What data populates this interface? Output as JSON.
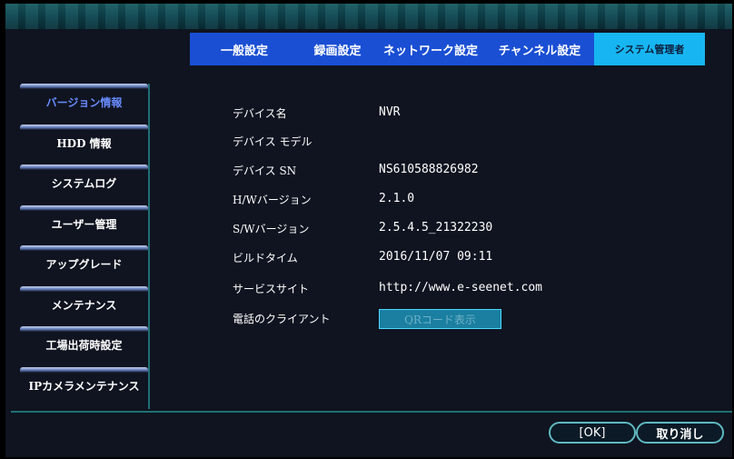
{
  "tabs": [
    {
      "label": "一般設定"
    },
    {
      "label": "録画設定"
    },
    {
      "label": "ネットワーク設定"
    },
    {
      "label": "チャンネル設定"
    },
    {
      "label": "システム管理者"
    }
  ],
  "sidebar": {
    "items": [
      {
        "label": "バージョン情報"
      },
      {
        "label": "HDD 情報"
      },
      {
        "label": "システムログ"
      },
      {
        "label": "ユーザー管理"
      },
      {
        "label": "アップグレード"
      },
      {
        "label": "メンテナンス"
      },
      {
        "label": "工場出荷時設定"
      },
      {
        "label": "IPカメラメンテナンス"
      }
    ]
  },
  "info": {
    "device_name_label": "デバイス名",
    "device_name_value": "NVR",
    "device_model_label": "デバイス モデル",
    "device_sn_label": "デバイス SN",
    "device_sn_value": "NS610588826982",
    "hw_version_label": "H/Wバージョン",
    "hw_version_value": "2.1.0",
    "sw_version_label": "S/Wバージョン",
    "sw_version_value": "2.5.4.5_21322230",
    "build_time_label": "ビルドタイム",
    "build_time_value": "2016/11/07 09:11",
    "service_site_label": "サービスサイト",
    "service_site_value": "http://www.e-seenet.com",
    "phone_client_label": "電話のクライアント",
    "qr_button_label": "QRコード表示"
  },
  "footer": {
    "ok_label": "[OK]",
    "cancel_label": "取り消し"
  }
}
